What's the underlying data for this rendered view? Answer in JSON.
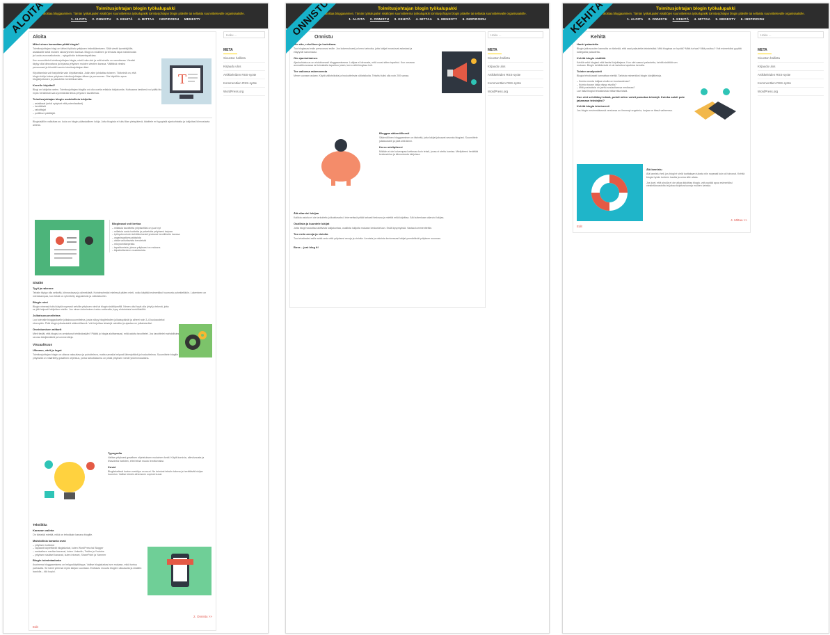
{
  "header": {
    "title": "Toimitusjohtajan blogin työkalupakki",
    "subtitle": "Helppo tapa aloittaa bloggaaminen. Tämän työkalupakin sisältöjen suunnittelema työkalupakki toimitusjohtajan blogin pitäville tai sellaista suunnittelevalle organisaatiolle.",
    "nav": [
      "1. ALOITA",
      "2. ONNISTU",
      "3. KEHITÄ",
      "4. MITTAA",
      "INSPIROIDU",
      "MENESTY"
    ],
    "nav3": [
      "1. ALOITA",
      "2. ONNISTU",
      "3. KEHITÄ",
      "4. MITTAA",
      "5. MENESTY",
      "6. INSPIROIDU"
    ]
  },
  "ribbons": [
    "ALOITA",
    "ONNISTU",
    "KEHITÄ"
  ],
  "sidebar": {
    "search_placeholder": "Haku ...",
    "meta_title": "META",
    "links": [
      "Sivuston hallinta",
      "Kirjaudu ulos",
      "Artikkeleiden RSS-syöte",
      "Kommenttien RSS-syöte",
      "WordPress.org"
    ]
  },
  "page1": {
    "title": "Aloita",
    "q1": "Miksi sinun kannattaa pitää blogia?",
    "p1": "Toimitusjohtajan blogi on tärkeä työkalu yrityksen brändäämiseen. Siltä viestit tyontekijöille, asiakkaille sekä muiden sidosryhmien kanssa. Blogi on edullinen ja tehokas tapa markkinoida ja luoda vuorovaikutusta – nykypäivän kohtaamispaikkaa.",
    "p2": "Kun suunnittelet toimitusjohtajan blogia, mieti kuka olet ja mitä sinulla on sanottavaa. Viestisi täytyy olla kiinnostava ja linjassa yrityksen muiden viestien kanssa. Välittävä viestisi persoonasi ja kiinnitä huomio toimitusjohtajan ääni.",
    "p3": "Kirjoittamista voit harjoitella vain kirjoittamalla. Jokin aihe johdattaa toiseen. Tärkeintä on, että blogin lukija kokee yrityksen toimitusjohtajan äänen ja persoonan. Ota käyttöön apua blogikirjoitusten ja palautetta henkilökunnalta.",
    "q2": "Kenelle kirjoitat?",
    "p4": "Blogi on lukijoita varten. Toimitusjohtajan blogilla voi olla useita erilaisia lukijakuntia. Kuttuaana kesikenä voi pitää blogia, jota kiinnostaa asiakkaita ja jonka kautta myös henkilöstö saa syventävää tietoa yrityksen tavoitteista.",
    "q3": "Toimitusjohtajan blogin mahdollisia lukijoita:",
    "list1": [
      "– asiakkaat (sekä nykyiset että potentiaaliset)",
      "– henkilöstö",
      "– rahoittajat",
      "– poliittiset päättäjät."
    ],
    "p5": "Blogisisällön valkuttaa se, kuka on blogin pääasiallinen lukija. Jotta blogista ei tulisi liian yleispätevä, käsittele eri tyyppisiä ajankohtaisia ja lukijoitasi kiinnostavia aiheita.",
    "q4": "Blogissasi voit kertoa",
    "list2": [
      "– millaisia tavoitteita yritykselläsi on juuri nyt",
      "– millaisia uusia tuotteita ja palveluita yrityksesi tarjoaa",
      "– työhyvinvoinnin kehittämisestä yhdessä henkilöstön kanssa",
      "– organisaatiomuutoksista",
      "– alalla vaikuttavista trendeistä",
      "– rekrytointitarpeista",
      "– tapahtumista, joissa yrityksesi on mukana",
      "– kilpailutilanteen muutoksista."
    ],
    "s_sisalto": "Sisältö",
    "q5": "Tyyli ja rakenne",
    "p6": "Tekstin täytyy olla selkeää, kiinnostavaa ja ytimekästä. Kohderyhmäsi mielessä pitäen mieti, voiko käyttää esimerkiksi huumoria puhekieltäkin. Lukeminen on mieluisampaa, kun teksti on ryhmitelty kappaleisiin ja väliotsikoihin.",
    "q6": "Blogin nimi",
    "p7": "Blogin nimessä tulisi käydä nopeasti selville yrityksen nimi tai blogin sisältöprofiili. Nimen olisi hyvä olla lyhyt ja tekevä, jotta se jää helposti lukijoiden mieliin. Jos nimen keksiminen tuntuu vaikealta, kysy ehdotuksia henkilöstöltä.",
    "q7": "Julkaisusuunnitelma",
    "p8": "Luo tulevalle bloggaukselle julkaisusuunnitelma, josta näkyy blogitekstien julkaisupäivät ja aiheet noin 3–6 kuukaudeksi eteenpäin. Pidä blogin julkaisutahti säännöllisenä. Voit kirjoittaa tekstejä valmiiksi ja ajastaa ne julkaistaviksi.",
    "q8": "Onnistumisen mittarit",
    "p9": "Mieti tiedät, että blogisi on onnistunut tehtävässään? Päätä jo blogia aloittaessasi, mitä asioita tavoittelet. Jos tavoittelet mahdollisimman suurta lukijakuntaa, seuraa kävijämääriä ja kommentteja.",
    "s_visual": "Visuaalisuus",
    "q9": "Ulkoasu, värit ja logot",
    "p10": "Toimitusjohtajan blogin on oltava vakuuttava ja puhutteleva, mutta samalla helposti lähestyttävä ja houkutteleva. Suunnittele blogille selkeä ulkoasu. Useilla yrityksillä on määritelty graafinen ohjeistus, jonka tarkoituksena on pitää yrityksen viestit yhdenmukaisina.",
    "q10": "Typografia",
    "p11": "Valitse yrityksesi graafisen ohjeistuksen mukainen fontti. Käytä kursivia, alleviivausta ja lihavointia harkiten, ettei teksti muutu levottomaksi.",
    "q11": "Kuvat",
    "p12": "Blogitekstissä kuvien merkitys on suuri. Ne toimivat tekstin tukena ja herättävät lukijan huomion. Valitse tekstin aiheeseen sopivat kuvat.",
    "s_tek": "Tekniikka",
    "q12": "Kanavan valinta",
    "p13": "On tärkeää miettiä, mikä on tehokkain kanava blogille.",
    "q13": "Mahdollisia kanavia ovat:",
    "list3": [
      "– yrityksen kotisivut",
      "– vapaasti käytettävät blogialustat, kuten WordPress tai Blogger",
      "– sosiaalisen median kanavat, kuten LinkedIn, Twitter ja Youtube",
      "– yrityksen sisäiset kanavat, kuten intranet, SharePoint ja Yammer"
    ],
    "q14": "Blogin toimintaalusta",
    "p14": "Avoimena bloggaamisena on helppokäyttöisyys. Valitse blogialustasi sen mukaan, mikä tuntuu parhaalta. Se toimii yleensä myös lukijan suuntaan. Erottautu muusta blogien ulkoasulla ja sisällön laadulla – älä kopioi.",
    "next": "2. Onnistu >>",
    "edit": "Edit"
  },
  "page2": {
    "title": "Onnistu",
    "q1": "Ole aito, rehellinen ja luotettava.",
    "p1": "Tuo blogissasi esiin persoonasi esille. Jos kokemuksesi ja kerro tarinoita, jotta lukijat innostuvat asiastasi ja eläytyvät sanomaasi.",
    "q2": "Ole ajankohtainen",
    "p2": "Ajankohtaisuus on ehdottomasti bloggaamisessa. Lukijaa ei kiinnosta, mitä vuosi sitten tapahtui. Kun omassa ammattikunnassa tai toimialalla tapahtuu jotain, kerro siitä blogissa heti.",
    "q3": "Tee valionsa rakenneesta",
    "p3": "Mene suoraan asiaan. Käytä väliotsikoita ja houkuttelevia väliotsikoita. Tekstisi tulisi olla noin 200 sanaa.",
    "q4": "Bloggaa säännöllisesti",
    "p4": "Säännöllinen bloggaaminen on tärkeää, jotta lukijat jaksavat seurata blogiasi. Suunnittele julkaisutahti ja pidä siitä kiinni.",
    "q5": "Kerro mielipiteesi",
    "p5": "Mikään ei ole kuivempaa luettavaa kuin teksti, jossa ei otettu kantaa. Mielipiteesi herättää keskustelua ja kiinnostusta lukijoissa.",
    "q6": "Älä aliarvioi lukijaa",
    "p6": "Kaikkia asioita ei ole tarkoitettu julkaistavaksi. Internetissä pitää tarkasti tiedossa ja miettiä mitä kirjoittaa. Älä kuitenkaan aliarvioi lukijaa.",
    "q7": "Osallista ja kuuntele lukijat",
    "p7": "Jotta blogi houkuttaa aktiivista lukijakuntaa, osallista lukijoita mukaan keskusteluun. Esitä kysymyksiä. Vastaa kommentteihin.",
    "q8": "Tuo esiin arvoja ja visioita",
    "p8": "Tuo tekstissäsi esille sekä omia että yrityksesi arvoja ja visioita. Arvoista ja visioista kertoessasi lukijat ymmärtävät yrityksen suunnan.",
    "outro": "Boss – just blog it!"
  },
  "page3": {
    "title": "Kehitä",
    "q1": "Hanki palautetta",
    "p1": "Blogin jatkuvuuden kannalta on tärkeää, että saat palautetta teksteistäsi. Mitä blogissa on hyvää? Mikä turhaa? Mitä puuttuu? Voit esimerkiksi pyytää kollegoilta palautetta.",
    "q2": "Kehitä blogin sisältöä",
    "p2": "Kehitä sekä blogiasi että itseäsi kirjoittajana. Kun olet saanut palautetta, kehitä sisältöä sen mukaan. Blogin kehittämistä ei ole tarkoitus tapahtua kerralla.",
    "q3": "Toisten analysointi",
    "p3": "Blogia tehokkaasti kannattaa miettiä. Tarkista esimerkiksi blogin kävijätietoja.",
    "list": [
      "– Kuinka monta lukijaa sinulla on kuukaudessa?",
      "– Kuinka kauan lukija viipyy sivulla?",
      "– Mitä postauksia on jaettu sosiaalisessa mediassa?"
    ],
    "p3b": "Lue lisää blogisi tehostavista mittareista tästä.",
    "q4": "Kun olet selvittänyt nämä, pohdi miten voisit parantaa tekstejä. Kuinka saisit potentiaalisia lukijoita ja miten saisit lukijat jakamaan tekstejäsi?",
    "q5": "Kehitä blogia tekniseesti",
    "p5": "Jos blogin ensimmäisessä versiossa on ilmennyt ongelmia, korjaa ne tässä vaiheessa.",
    "q6": "Älä lannistu",
    "p6": "Älä lannistu heti, jos blogi ei vielä tuottakaan tulosta niin nopeasti kuin oli toivonut. Kehitä blogia hyvän tunteen kautta ja anna sille aikaa.",
    "p7": "Jos koet, että sinulla ei ole aikaa kirjoittaa blogia, voit pyytää apua esimerkiksi viestintäosastolta tai jakaa kirjoitusvuoroja muiden kanssa.",
    "next": "4. Mittaa >>",
    "edit": "Edit"
  }
}
